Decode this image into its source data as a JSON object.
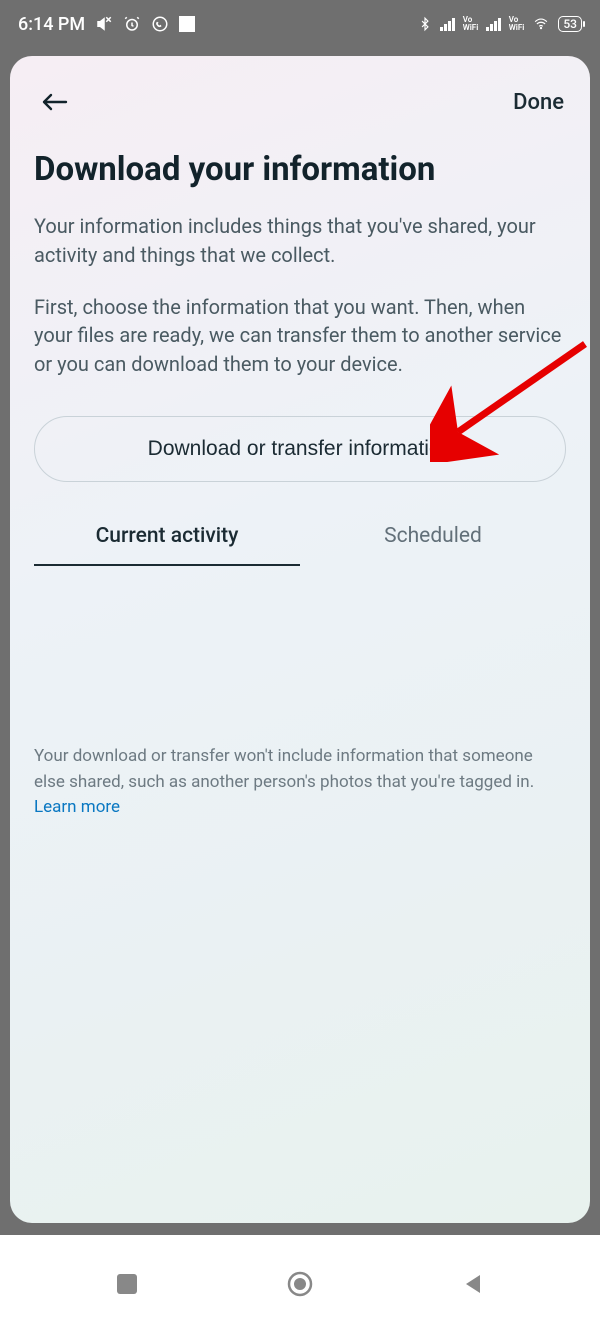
{
  "status": {
    "time": "6:14 PM",
    "battery": "53"
  },
  "header": {
    "done": "Done"
  },
  "page": {
    "title": "Download your information",
    "desc1": "Your information includes things that you've shared, your activity and things that we collect.",
    "desc2": "First, choose the information that you want. Then, when your files are ready, we can transfer them to another service or you can download them to your device.",
    "primary_button": "Download or transfer information"
  },
  "tabs": {
    "current": "Current activity",
    "scheduled": "Scheduled"
  },
  "footer": {
    "note": "Your download or transfer won't include information that someone else shared, such as another person's photos that you're tagged in. ",
    "link": "Learn more"
  }
}
